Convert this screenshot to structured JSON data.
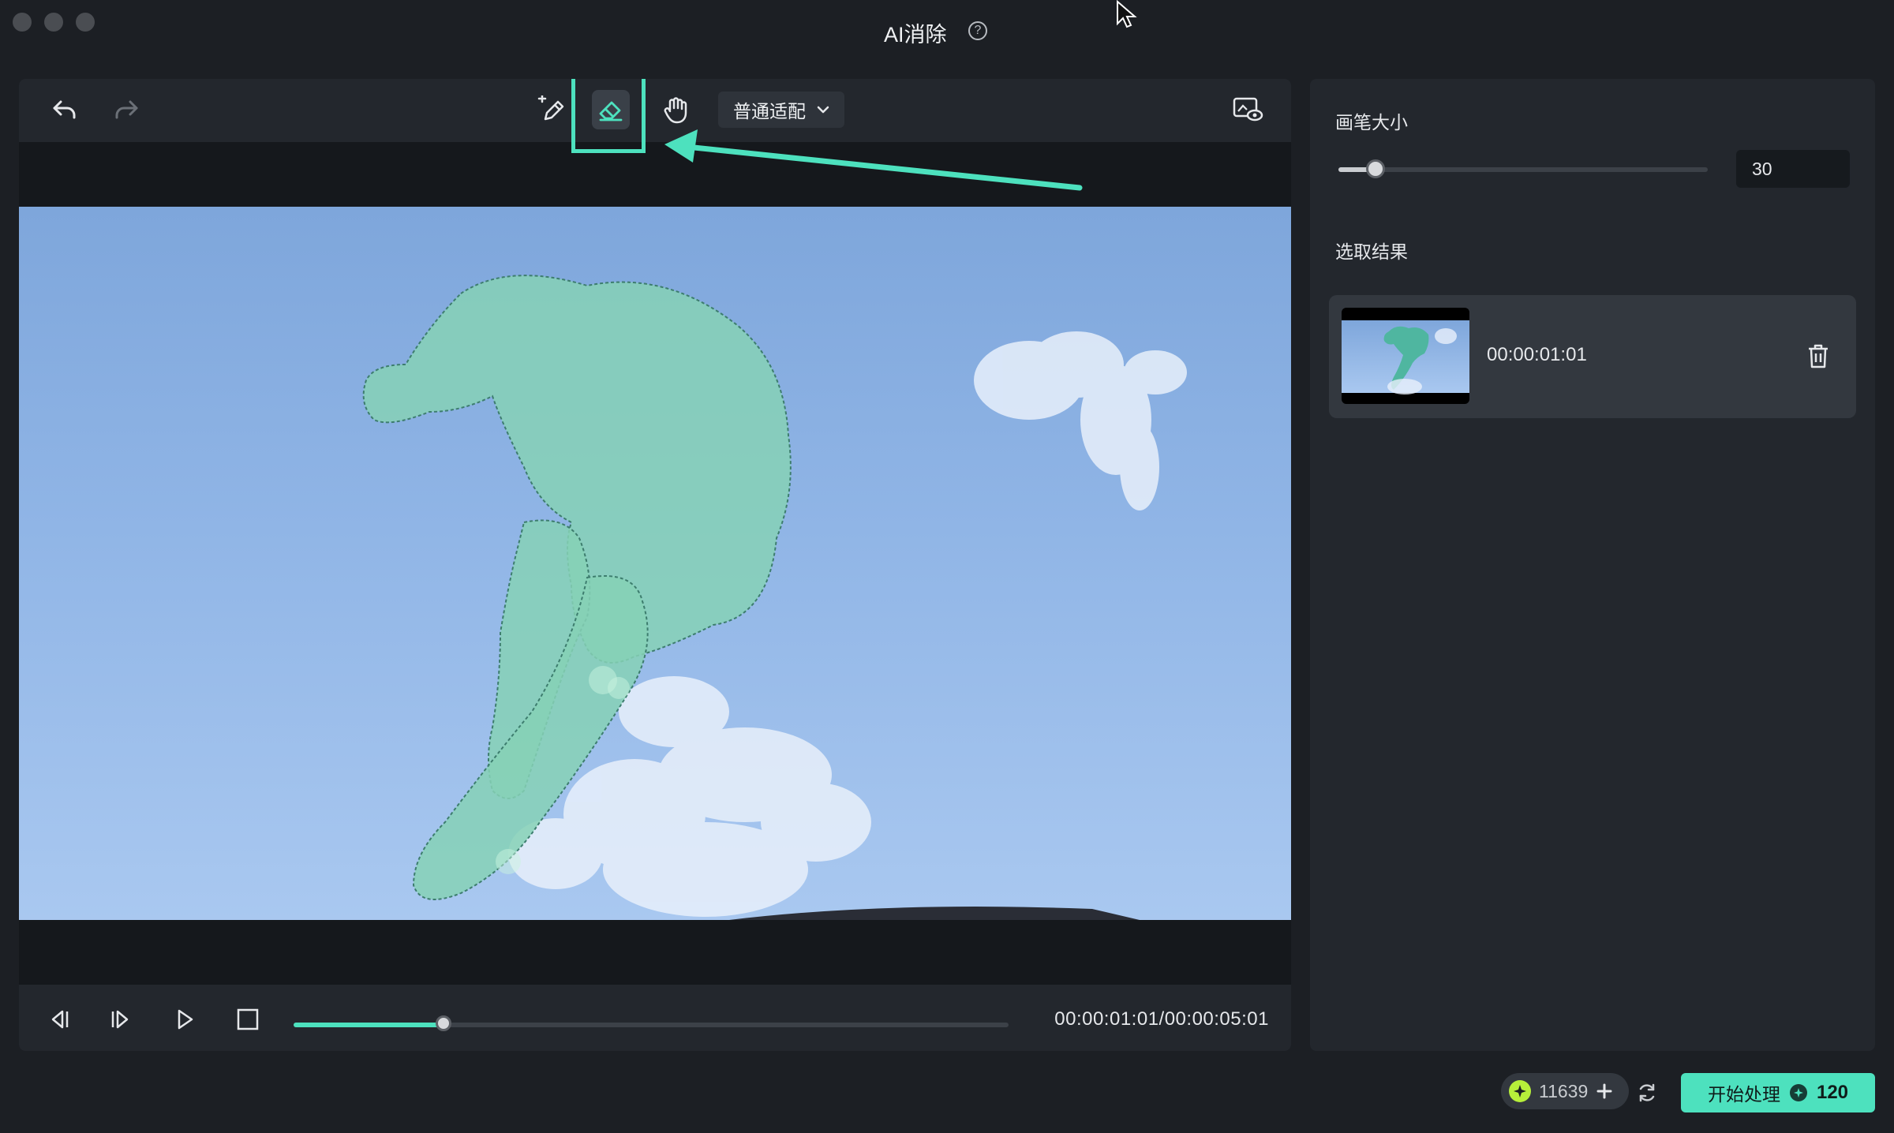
{
  "window": {
    "title": "AI消除"
  },
  "toolbar": {
    "undo_icon": "undo-icon",
    "redo_icon": "redo-icon",
    "brush_icon": "brush-add-icon",
    "eraser_icon": "eraser-icon",
    "hand_icon": "hand-icon",
    "fit_mode": "普通适配",
    "preview_icon": "preview-eye-icon"
  },
  "playback": {
    "current_time": "00:00:01:01",
    "total_time": "00:00:05:01",
    "time_display": "00:00:01:01/00:00:05:01",
    "progress": 0.21
  },
  "side_panel": {
    "brush_size_label": "画笔大小",
    "brush_size_value": "30",
    "brush_size_fraction": 0.1,
    "results_label": "选取结果",
    "results": [
      {
        "time": "00:00:01:01"
      }
    ]
  },
  "footer": {
    "credits": "11639",
    "start_label": "开始处理",
    "start_cost": "120"
  },
  "colors": {
    "accent": "#4de1be",
    "background": "#1c1f24",
    "panel": "#23272d",
    "credit_icon": "#b6ef3a"
  }
}
